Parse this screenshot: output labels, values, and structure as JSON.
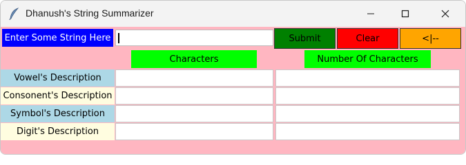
{
  "window": {
    "title": "Dhanush's String Summarizer",
    "icon": "feather-icon"
  },
  "form": {
    "prompt_label": "Enter Some String Here",
    "input_value": "",
    "submit_label": "Submit",
    "clear_label": "Clear",
    "back_label": "<|--"
  },
  "headers": {
    "characters": "Characters",
    "count": "Number Of Characters"
  },
  "rows": [
    {
      "label": "Vowel's Description",
      "characters": "",
      "count": ""
    },
    {
      "label": "Consonent's Description",
      "characters": "",
      "count": ""
    },
    {
      "label": "Symbol's Description",
      "characters": "",
      "count": ""
    },
    {
      "label": "Digit's Description",
      "characters": "",
      "count": ""
    }
  ],
  "colors": {
    "background": "#ffb6c1",
    "prompt_bg": "#0000ff",
    "submit_bg": "#008000",
    "clear_bg": "#ff0000",
    "back_bg": "#ffa500",
    "header_bg": "#00ff00",
    "label_blue": "#add8e6",
    "label_cream": "#fffde0"
  }
}
